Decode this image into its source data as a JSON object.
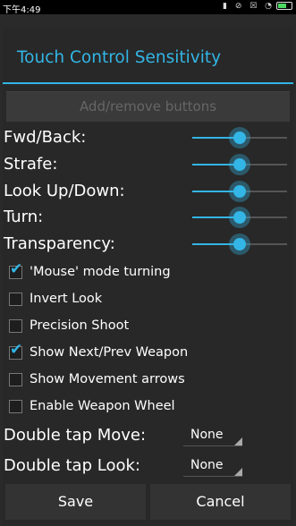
{
  "status_bar": {
    "time": "下午4:49",
    "icons": "▮ ⊘ ☒ ◔"
  },
  "dialog": {
    "title": "Touch Control Sensitivity",
    "add_remove_label": "Add/remove buttons",
    "sliders": [
      {
        "label": "Fwd/Back:",
        "value": 0.5
      },
      {
        "label": "Strafe:",
        "value": 0.5
      },
      {
        "label": "Look Up/Down:",
        "value": 0.5
      },
      {
        "label": "Turn:",
        "value": 0.5
      },
      {
        "label": "Transparency:",
        "value": 0.5
      }
    ],
    "checkboxes": [
      {
        "label": "'Mouse' mode turning",
        "checked": true
      },
      {
        "label": "Invert Look",
        "checked": false
      },
      {
        "label": "Precision Shoot",
        "checked": false
      },
      {
        "label": "Show Next/Prev Weapon",
        "checked": true
      },
      {
        "label": "Show Movement arrows",
        "checked": false
      },
      {
        "label": "Enable Weapon Wheel",
        "checked": false
      }
    ],
    "dropdowns": [
      {
        "label": "Double tap Move:",
        "value": "None"
      },
      {
        "label": "Double tap Look:",
        "value": "None"
      }
    ],
    "save_label": "Save",
    "cancel_label": "Cancel"
  },
  "colors": {
    "accent": "#33b5e5",
    "background": "#282828"
  }
}
